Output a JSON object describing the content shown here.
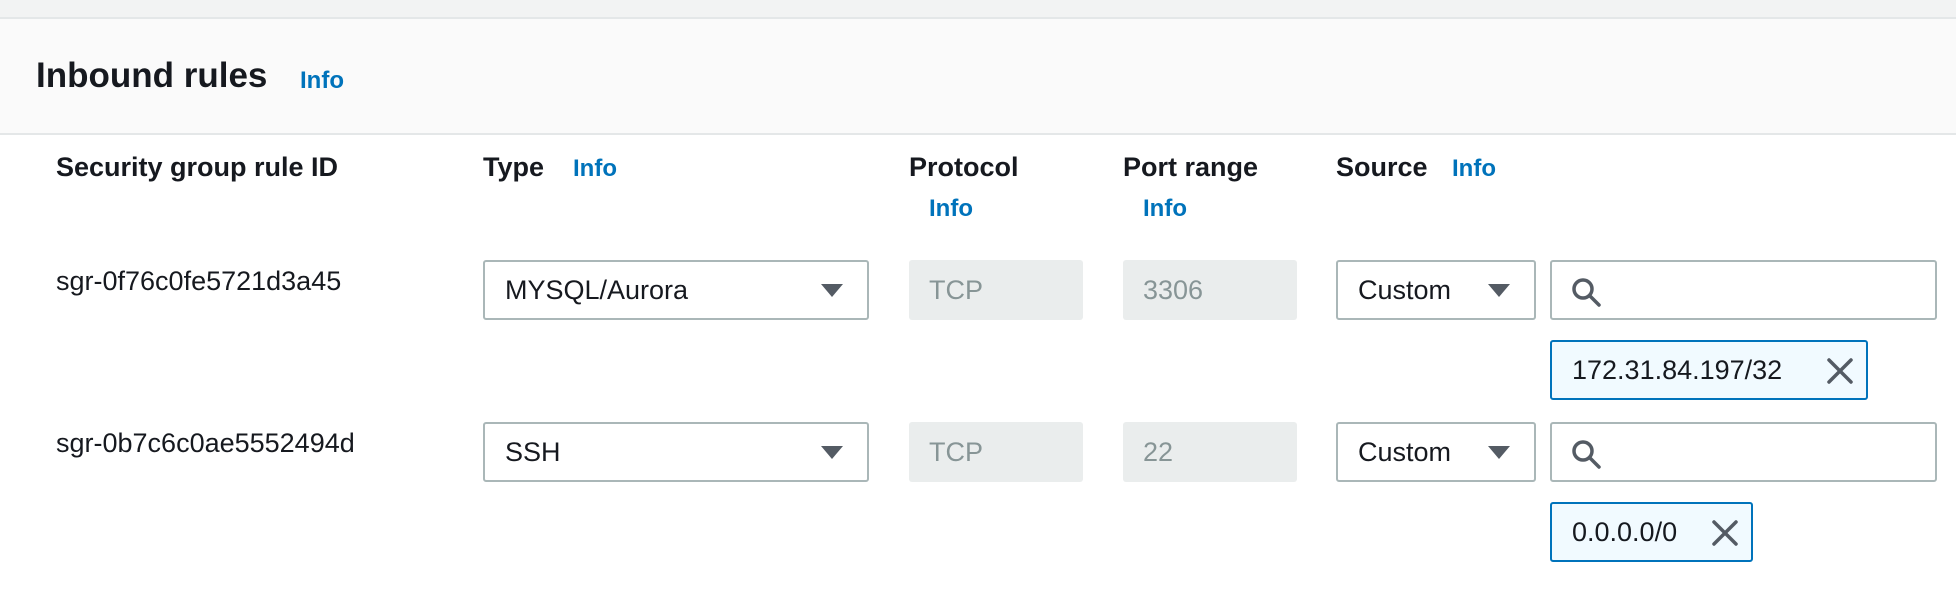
{
  "header": {
    "title": "Inbound rules",
    "info_label": "Info"
  },
  "columns": {
    "rule_id": "Security group rule ID",
    "type": "Type",
    "type_info": "Info",
    "protocol": "Protocol",
    "protocol_info": "Info",
    "port_range": "Port range",
    "port_range_info": "Info",
    "source": "Source",
    "source_info": "Info"
  },
  "rules": [
    {
      "id": "sgr-0f76c0fe5721d3a45",
      "type": "MYSQL/Aurora",
      "protocol": "TCP",
      "port_range": "3306",
      "source_type": "Custom",
      "search_placeholder": "",
      "token": "172.31.84.197/32"
    },
    {
      "id": "sgr-0b7c6c0ae5552494d",
      "type": "SSH",
      "protocol": "TCP",
      "port_range": "22",
      "source_type": "Custom",
      "search_placeholder": "",
      "token": "0.0.0.0/0"
    }
  ],
  "icons": {
    "dropdown": "caret-down-icon",
    "search": "search-icon",
    "remove": "close-icon"
  },
  "colors": {
    "link": "#0073bb",
    "token_border": "#0073bb",
    "token_bg": "#f1faff",
    "disabled_bg": "#eaeded",
    "disabled_text": "#879596",
    "header_bg": "#fafafa"
  }
}
